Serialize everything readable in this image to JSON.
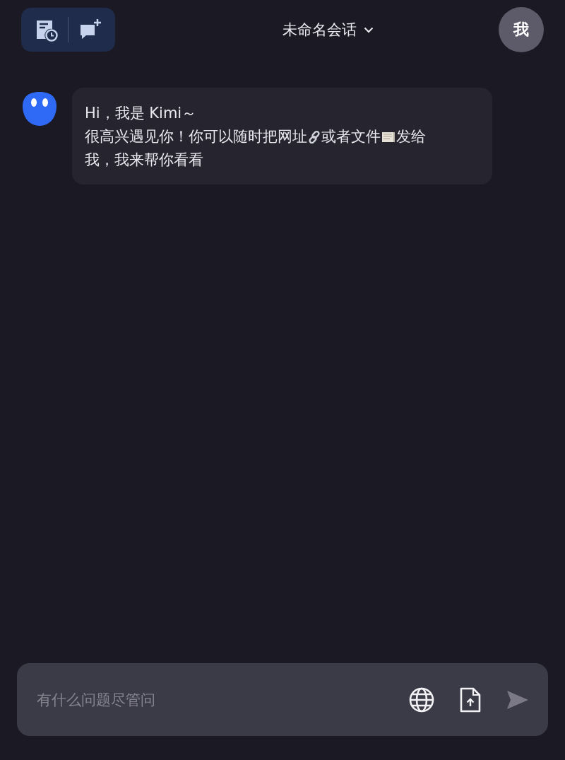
{
  "header": {
    "title": "未命名会话",
    "avatar_label": "我"
  },
  "messages": [
    {
      "lines": [
        [
          {
            "kind": "text",
            "text": "Hi，我是 Kimi～"
          }
        ],
        [
          {
            "kind": "text",
            "text": "很高兴遇见你！你可以随时把网址"
          },
          {
            "kind": "link-icon"
          },
          {
            "kind": "text",
            "text": "或者文件"
          },
          {
            "kind": "document-icon"
          },
          {
            "kind": "text",
            "text": "发给"
          }
        ],
        [
          {
            "kind": "text",
            "text": "我，我来帮你看看"
          }
        ]
      ]
    }
  ],
  "composer": {
    "placeholder": "有什么问题尽管问",
    "send_disabled": true
  }
}
